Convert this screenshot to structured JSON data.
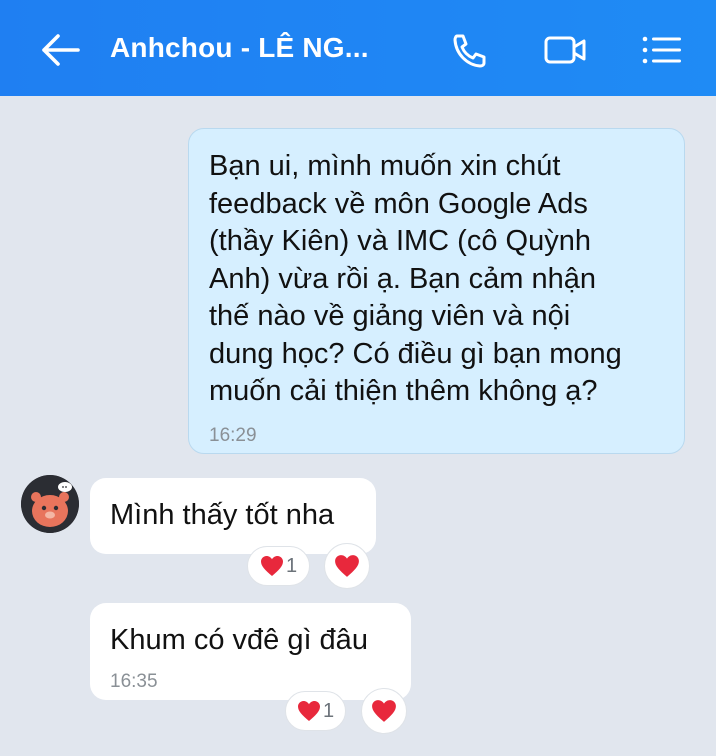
{
  "header": {
    "title": "Anhchou - LÊ NG...",
    "background": "#1f85f4",
    "icons": [
      "back-arrow-icon",
      "phone-icon",
      "video-call-icon",
      "menu-icon"
    ]
  },
  "messages": [
    {
      "direction": "outgoing",
      "lines": [
        "Bạn ui, mình muốn xin chút",
        "feedback về môn Google Ads",
        "(thầy Kiên) và IMC (cô Quỳnh",
        "Anh) vừa rồi ạ. Bạn cảm nhận",
        "thế nào về giảng viên và nội",
        "dung học? Có điều gì bạn mong",
        "muốn cải thiện thêm không ạ?"
      ],
      "time": "16:29"
    },
    {
      "direction": "incoming",
      "text": "Mình thấy tốt nha",
      "reaction_count": "1"
    },
    {
      "direction": "incoming",
      "text": "Khum có vđê gì đâu",
      "time": "16:35",
      "reaction_count": "1"
    }
  ],
  "colors": {
    "outgoing_bubble": "#d6efff",
    "incoming_bubble": "#ffffff",
    "chat_background": "#e1e6ee",
    "heart": "#e8283c"
  }
}
